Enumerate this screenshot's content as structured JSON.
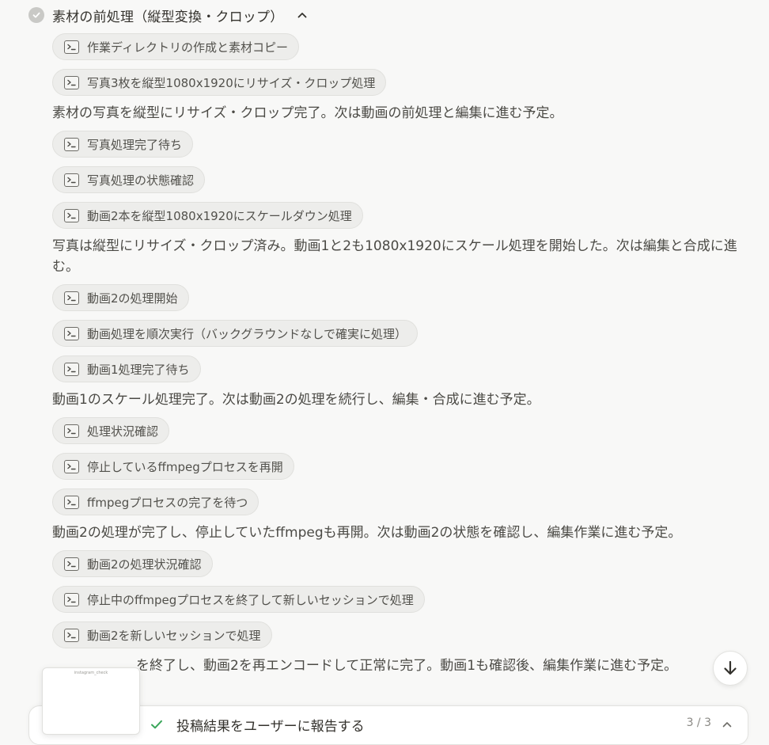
{
  "section": {
    "title": "素材の前処理（縦型変換・クロップ）",
    "status_icon": "check-circle-icon",
    "toggle_icon": "chevron-up-icon"
  },
  "items": [
    {
      "kind": "step",
      "label": "作業ディレクトリの作成と素材コピー",
      "icon": "terminal-icon"
    },
    {
      "kind": "step",
      "label": "写真3枚を縦型1080x1920にリサイズ・クロップ処理",
      "icon": "terminal-icon"
    },
    {
      "kind": "note",
      "text": "素材の写真を縦型にリサイズ・クロップ完了。次は動画の前処理と編集に進む予定。"
    },
    {
      "kind": "step",
      "label": "写真処理完了待ち",
      "icon": "terminal-icon"
    },
    {
      "kind": "step",
      "label": "写真処理の状態確認",
      "icon": "terminal-icon"
    },
    {
      "kind": "step",
      "label": "動画2本を縦型1080x1920にスケールダウン処理",
      "icon": "terminal-icon"
    },
    {
      "kind": "note",
      "text": "写真は縦型にリサイズ・クロップ済み。動画1と2も1080x1920にスケール処理を開始した。次は編集と合成に進む。"
    },
    {
      "kind": "step",
      "label": "動画2の処理開始",
      "icon": "terminal-icon"
    },
    {
      "kind": "step",
      "label": "動画処理を順次実行（バックグラウンドなしで確実に処理）",
      "icon": "terminal-icon"
    },
    {
      "kind": "step",
      "label": "動画1処理完了待ち",
      "icon": "terminal-icon"
    },
    {
      "kind": "note",
      "text": "動画1のスケール処理完了。次は動画2の処理を続行し、編集・合成に進む予定。"
    },
    {
      "kind": "step",
      "label": "処理状況確認",
      "icon": "terminal-icon"
    },
    {
      "kind": "step",
      "label": "停止しているffmpegプロセスを再開",
      "icon": "terminal-icon"
    },
    {
      "kind": "step",
      "label": "ffmpegプロセスの完了を待つ",
      "icon": "terminal-icon"
    },
    {
      "kind": "note",
      "text": "動画2の処理が完了し、停止していたffmpegも再開。次は動画2の状態を確認し、編集作業に進む予定。"
    },
    {
      "kind": "step",
      "label": "動画2の処理状況確認",
      "icon": "terminal-icon"
    },
    {
      "kind": "step",
      "label": "停止中のffmpegプロセスを終了して新しいセッションで処理",
      "icon": "terminal-icon"
    },
    {
      "kind": "step",
      "label": "動画2を新しいセッションで処理",
      "icon": "terminal-icon"
    },
    {
      "kind": "note",
      "text": "を終了し、動画2を再エンコードして正常に完了。動画1も確認後、編集作業に進む予定。",
      "indent": true
    }
  ],
  "thumbnail": {
    "label": "instagram_check"
  },
  "task_bar": {
    "label": "投稿結果をユーザーに報告する",
    "count": "3 / 3",
    "status_icon": "check-icon",
    "toggle_icon": "chevron-up-icon"
  },
  "scroll_button": {
    "icon": "arrow-down-icon"
  }
}
